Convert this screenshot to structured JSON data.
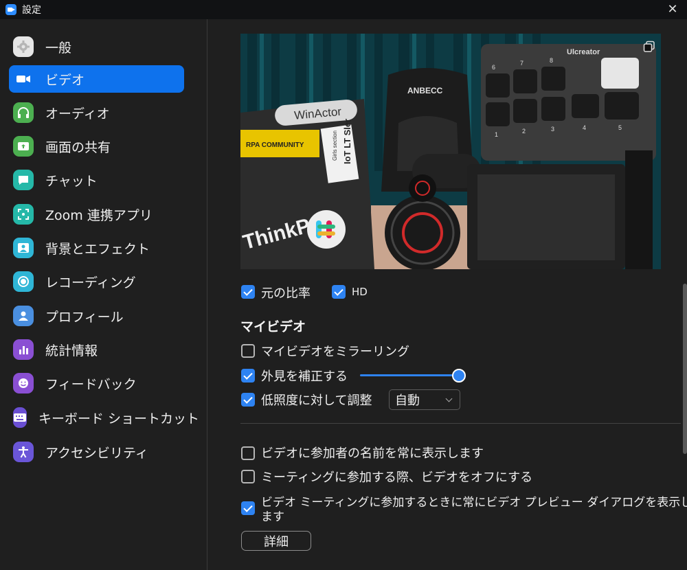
{
  "window": {
    "title": "設定"
  },
  "sidebar": {
    "items": [
      {
        "label": "一般",
        "icon": "gear-icon",
        "color": "#e6e6e6"
      },
      {
        "label": "ビデオ",
        "icon": "video-camera-icon",
        "color": "#0e72ed",
        "active": true
      },
      {
        "label": "オーディオ",
        "icon": "headphones-icon",
        "color": "#4caf50"
      },
      {
        "label": "画面の共有",
        "icon": "share-screen-icon",
        "color": "#4caf50"
      },
      {
        "label": "チャット",
        "icon": "chat-bubble-icon",
        "color": "#25b8a8"
      },
      {
        "label": "Zoom 連携アプリ",
        "icon": "apps-icon",
        "color": "#25b8a8"
      },
      {
        "label": "背景とエフェクト",
        "icon": "portrait-icon",
        "color": "#2fb6d6"
      },
      {
        "label": "レコーディング",
        "icon": "record-icon",
        "color": "#2fb6d6"
      },
      {
        "label": "プロフィール",
        "icon": "person-icon",
        "color": "#4a8fe0"
      },
      {
        "label": "統計情報",
        "icon": "stats-icon",
        "color": "#8a4fd3"
      },
      {
        "label": "フィードバック",
        "icon": "smiley-icon",
        "color": "#8a4fd3"
      },
      {
        "label": "キーボード ショートカット",
        "icon": "keyboard-icon",
        "color": "#6a4fd3"
      },
      {
        "label": "アクセシビリティ",
        "icon": "accessibility-icon",
        "color": "#6a56d8"
      }
    ]
  },
  "video": {
    "original_ratio_label": "元の比率",
    "original_ratio_checked": true,
    "hd_label": "HD",
    "hd_checked": true,
    "my_video_title": "マイビデオ",
    "mirror_label": "マイビデオをミラーリング",
    "mirror_checked": false,
    "touch_up_label": "外見を補正する",
    "touch_up_checked": true,
    "touch_up_level": 1.0,
    "low_light_label": "低照度に対して調整",
    "low_light_checked": true,
    "low_light_value": "自動",
    "show_names_label": "ビデオに参加者の名前を常に表示します",
    "show_names_checked": false,
    "turn_off_label": "ミーティングに参加する際、ビデオをオフにする",
    "turn_off_checked": false,
    "preview_dialog_label_line1": "ビデオ ミーティングに参加するときに常にビデオ プレビュー ダイアログを表示し",
    "preview_dialog_label_line2": "ます",
    "preview_dialog_checked": true,
    "advanced_button": "詳細"
  },
  "camera_preview": {
    "laptop_sticker": "WinActor",
    "laptop_brand": "ThinkPad",
    "community_sticker": "RPA COMMUNITY",
    "iot_sticker": "IoT LT Sler",
    "girls_sticker": "Girls section",
    "chair_brand": "ANBECC",
    "keypad_brand": "Ulcreator",
    "keypad_numbers_top": [
      "6",
      "7",
      "8"
    ],
    "keypad_numbers_bottom": [
      "1",
      "2",
      "3",
      "4",
      "5"
    ]
  },
  "colors": {
    "accent": "#0e72ed",
    "checkbox": "#2e83f2",
    "background": "#1f1f1f"
  }
}
